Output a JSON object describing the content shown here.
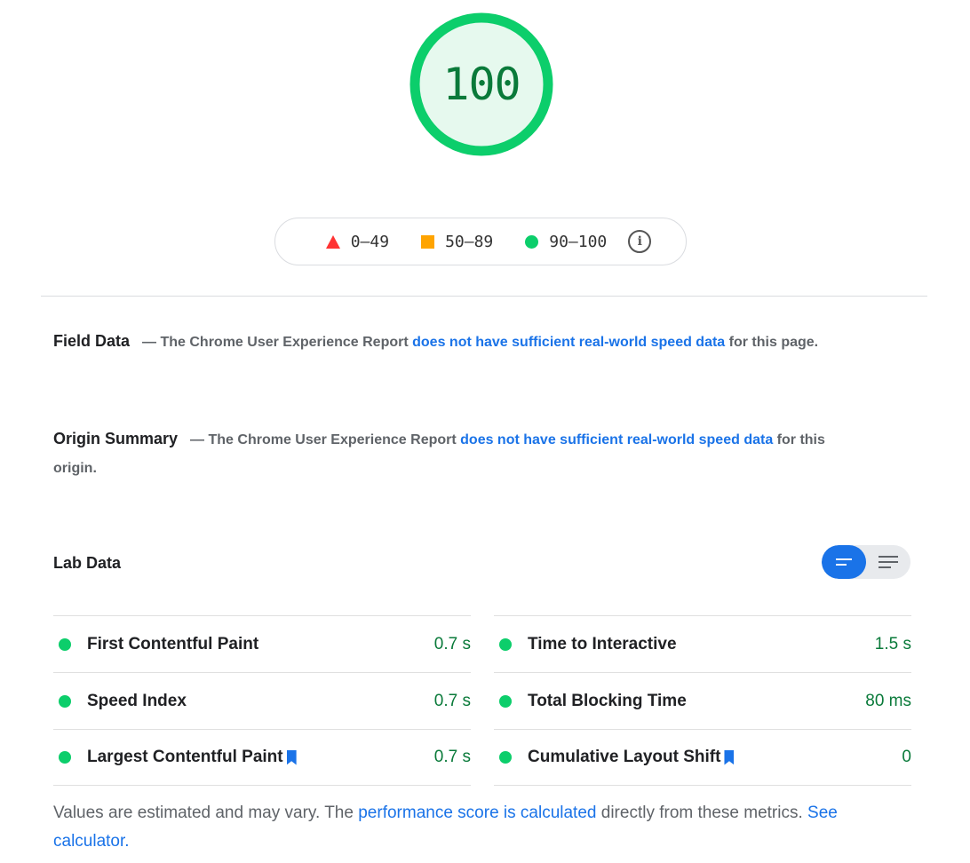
{
  "score": {
    "value": "100",
    "color": "#0cce6b"
  },
  "legend": {
    "items": [
      {
        "range": "0–49",
        "shape": "triangle",
        "color": "#ff3333"
      },
      {
        "range": "50–89",
        "shape": "square",
        "color": "#ffa400"
      },
      {
        "range": "90–100",
        "shape": "circle",
        "color": "#0cce6b"
      }
    ],
    "info_icon": "info-icon"
  },
  "field_data": {
    "title": "Field Data",
    "prefix": "— The Chrome User Experience Report ",
    "link": "does not have sufficient real-world speed data",
    "suffix": " for this page."
  },
  "origin_summary": {
    "title": "Origin Summary",
    "prefix": "— The Chrome User Experience Report ",
    "link": "does not have sufficient real-world speed data",
    "suffix": " for this origin."
  },
  "lab_data": {
    "title": "Lab Data",
    "toggle": {
      "selected": "summary",
      "options": [
        "summary-view",
        "detailed-view"
      ]
    },
    "left": [
      {
        "name": "First Contentful Paint",
        "value": "0.7 s",
        "bookmark": false
      },
      {
        "name": "Speed Index",
        "value": "0.7 s",
        "bookmark": false
      },
      {
        "name": "Largest Contentful Paint",
        "value": "0.7 s",
        "bookmark": true
      }
    ],
    "right": [
      {
        "name": "Time to Interactive",
        "value": "1.5 s",
        "bookmark": false
      },
      {
        "name": "Total Blocking Time",
        "value": "80 ms",
        "bookmark": false
      },
      {
        "name": "Cumulative Layout Shift",
        "value": "0",
        "bookmark": true
      }
    ]
  },
  "footnote": {
    "text1": "Values are estimated and may vary. The ",
    "link1": "performance score is calculated",
    "text2": " directly from these metrics. ",
    "link2": "See calculator."
  },
  "colors": {
    "pass": "#0cce6b",
    "pass_text": "#0a7a3a",
    "link": "#1a73e8"
  }
}
